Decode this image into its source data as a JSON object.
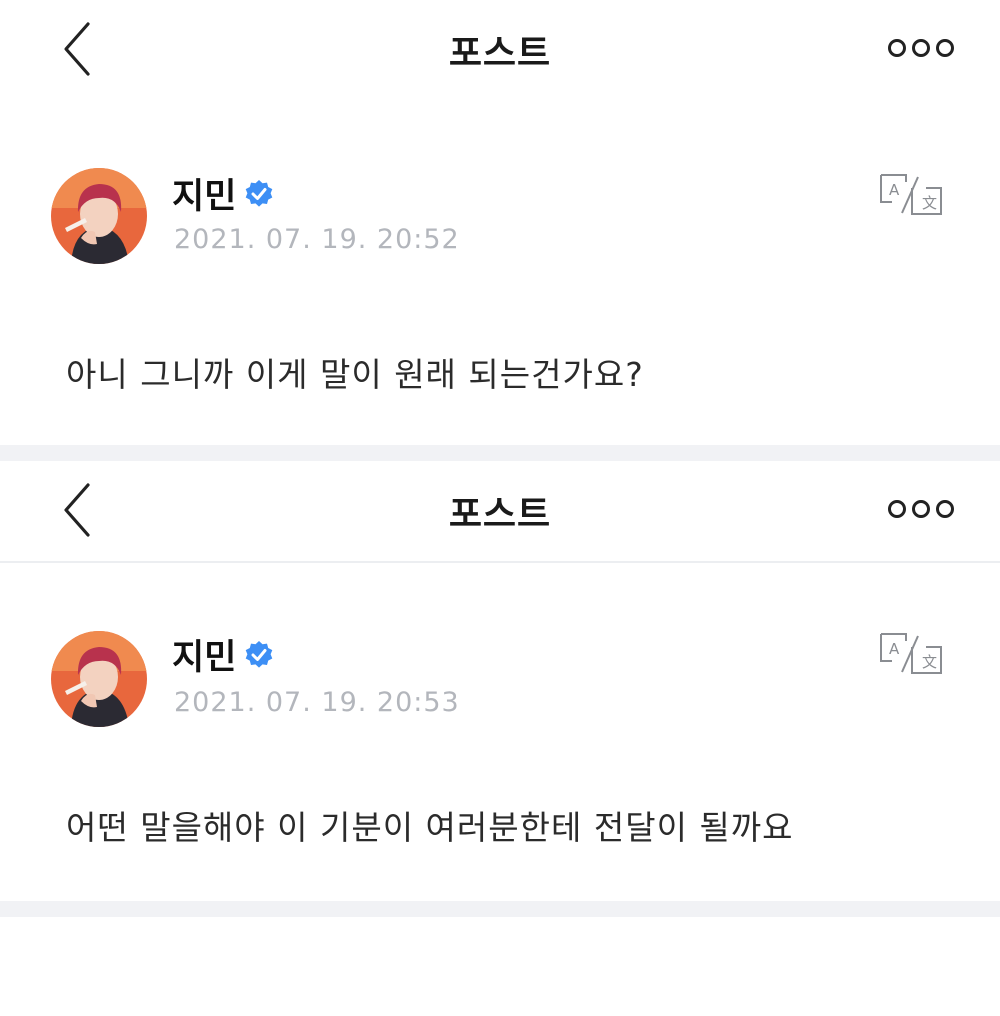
{
  "posts": [
    {
      "header": {
        "title": "포스트",
        "back_icon": "chevron-left-icon",
        "more_icon": "more-dots-icon"
      },
      "author": {
        "name": "지민",
        "verified": true,
        "badge_color": "#3d8ff5"
      },
      "timestamp": "2021. 07. 19. 20:52",
      "translate_icon": "translate-icon",
      "content": "아니 그니까 이게 말이 원래 되는건가요?"
    },
    {
      "header": {
        "title": "포스트",
        "back_icon": "chevron-left-icon",
        "more_icon": "more-dots-icon"
      },
      "author": {
        "name": "지민",
        "verified": true,
        "badge_color": "#3d8ff5"
      },
      "timestamp": "2021. 07. 19. 20:53",
      "translate_icon": "translate-icon",
      "content": "어떤 말을해야 이 기분이 여러분한테 전달이 될까요"
    }
  ],
  "colors": {
    "separator": "#f1f2f5",
    "timestamp": "#b3b6bc",
    "avatar_background": "#e8673d"
  }
}
